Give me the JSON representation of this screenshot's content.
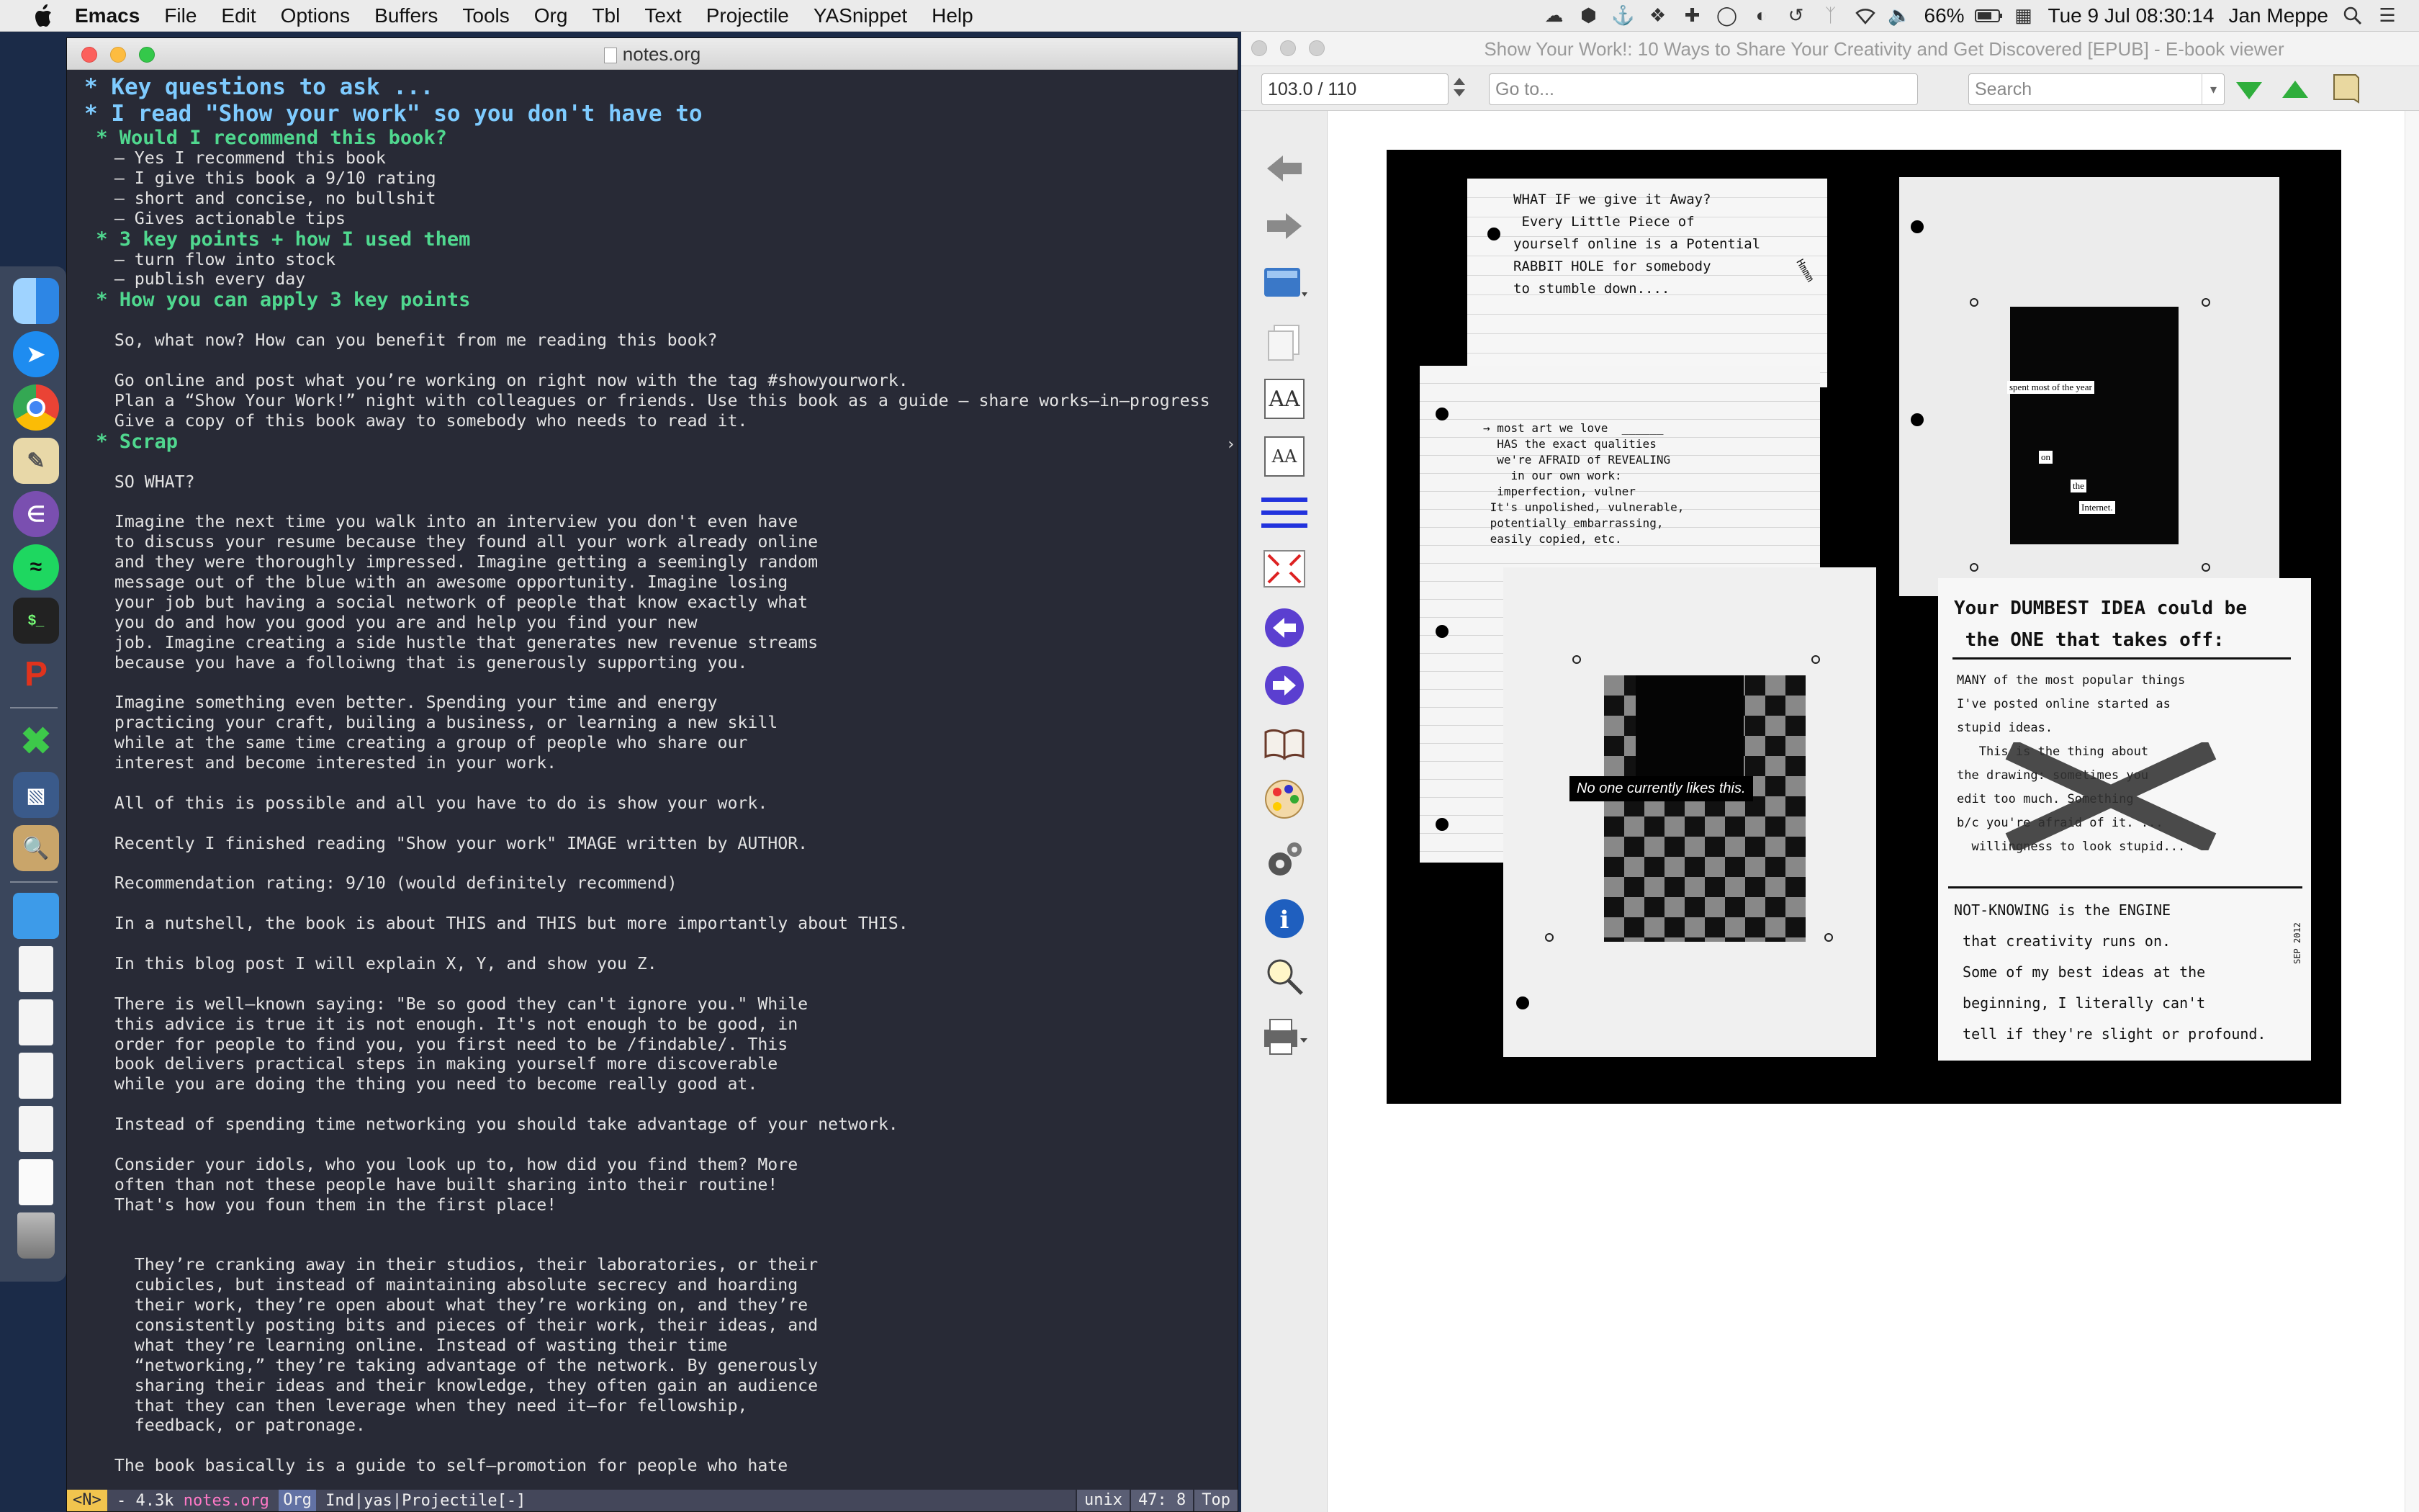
{
  "menubar": {
    "app_name": "Emacs",
    "menus": [
      "File",
      "Edit",
      "Options",
      "Buffers",
      "Tools",
      "Org",
      "Tbl",
      "Text",
      "Projectile",
      "YASnippet",
      "Help"
    ],
    "battery": "66%",
    "datetime": "Tue 9 Jul  08:30:14",
    "user": "Jan Meppe"
  },
  "emacs": {
    "title": "notes.org",
    "lines": [
      {
        "t": "* Key questions to ask ...",
        "s": "h1"
      },
      {
        "t": "* I read \"Show your work\" so you don't have to",
        "s": "h1"
      },
      {
        "t": " * Would I recommend this book?",
        "s": "h2"
      },
      {
        "t": "   – Yes I recommend this book",
        "s": ""
      },
      {
        "t": "   – I give this book a 9/10 rating",
        "s": ""
      },
      {
        "t": "   – short and concise, no bullshit",
        "s": ""
      },
      {
        "t": "   – Gives actionable tips",
        "s": ""
      },
      {
        "t": " * 3 key points + how I used them",
        "s": "h2"
      },
      {
        "t": "   – turn flow into stock",
        "s": ""
      },
      {
        "t": "   – publish every day",
        "s": ""
      },
      {
        "t": " * How you can apply 3 key points",
        "s": "h2"
      },
      {
        "t": "",
        "s": ""
      },
      {
        "t": "   So, what now? How can you benefit from me reading this book?",
        "s": ""
      },
      {
        "t": "",
        "s": ""
      },
      {
        "t": "   Go online and post what you’re working on right now with the tag #showyourwork.",
        "s": ""
      },
      {
        "t": "   Plan a “Show Your Work!” night with colleagues or friends. Use this book as a guide — share works–in–progress",
        "s": ""
      },
      {
        "t": "   Give a copy of this book away to somebody who needs to read it.",
        "s": ""
      },
      {
        "t": " * Scrap",
        "s": "h2"
      },
      {
        "t": "",
        "s": ""
      },
      {
        "t": "   SO WHAT?",
        "s": ""
      },
      {
        "t": "",
        "s": ""
      },
      {
        "t": "   Imagine the next time you walk into an interview you don't even have",
        "s": ""
      },
      {
        "t": "   to discuss your resume because they found all your work already online",
        "s": ""
      },
      {
        "t": "   and they were thoroughly impressed. Imagine getting a seemingly random",
        "s": ""
      },
      {
        "t": "   message out of the blue with an awesome opportunity. Imagine losing",
        "s": ""
      },
      {
        "t": "   your job but having a social network of people that know exactly what",
        "s": ""
      },
      {
        "t": "   you do and how you good you are and help you find your new",
        "s": ""
      },
      {
        "t": "   job. Imagine creating a side hustle that generates new revenue streams",
        "s": ""
      },
      {
        "t": "   because you have a folloiwng that is generously supporting you.",
        "s": ""
      },
      {
        "t": "",
        "s": ""
      },
      {
        "t": "   Imagine something even better. Spending your time and energy",
        "s": ""
      },
      {
        "t": "   practicing your craft, builing a business, or learning a new skill",
        "s": ""
      },
      {
        "t": "   while at the same time creating a group of people who share our",
        "s": ""
      },
      {
        "t": "   interest and become interested in your work.",
        "s": ""
      },
      {
        "t": "",
        "s": ""
      },
      {
        "t": "   All of this is possible and all you have to do is show your work.",
        "s": ""
      },
      {
        "t": "",
        "s": ""
      },
      {
        "t": "   Recently I finished reading \"Show your work\" IMAGE written by AUTHOR.",
        "s": ""
      },
      {
        "t": "",
        "s": ""
      },
      {
        "t": "   Recommendation rating: 9/10 (would definitely recommend)",
        "s": ""
      },
      {
        "t": "",
        "s": ""
      },
      {
        "t": "   In a nutshell, the book is about THIS and THIS but more importantly about THIS.",
        "s": ""
      },
      {
        "t": "",
        "s": ""
      },
      {
        "t": "   In this blog post I will explain X, Y, and show you Z.",
        "s": ""
      },
      {
        "t": "",
        "s": ""
      },
      {
        "t": "   There is well–known saying: \"Be so good they can't ignore you.\" While",
        "s": ""
      },
      {
        "t": "   this advice is true it is not enough. It's not enough to be good, in",
        "s": ""
      },
      {
        "t": "   order for people to find you, you first need to be /findable/. This",
        "s": ""
      },
      {
        "t": "   book delivers practical steps in making yourself more discoverable",
        "s": ""
      },
      {
        "t": "   while you are doing the thing you need to become really good at.",
        "s": ""
      },
      {
        "t": "",
        "s": ""
      },
      {
        "t": "   Instead of spending time networking you should take advantage of your network.",
        "s": ""
      },
      {
        "t": "",
        "s": ""
      },
      {
        "t": "   Consider your idols, who you look up to, how did you find them? More",
        "s": ""
      },
      {
        "t": "   often than not these people have built sharing into their routine!",
        "s": ""
      },
      {
        "t": "   That's how you foun them in the first place!",
        "s": ""
      },
      {
        "t": "",
        "s": ""
      },
      {
        "t": "",
        "s": ""
      },
      {
        "t": "     They’re cranking away in their studios, their laboratories, or their",
        "s": ""
      },
      {
        "t": "     cubicles, but instead of maintaining absolute secrecy and hoarding",
        "s": ""
      },
      {
        "t": "     their work, they’re open about what they’re working on, and they’re",
        "s": ""
      },
      {
        "t": "     consistently posting bits and pieces of their work, their ideas, and",
        "s": ""
      },
      {
        "t": "     what they’re learning online. Instead of wasting their time",
        "s": ""
      },
      {
        "t": "     “networking,” they’re taking advantage of the network. By generously",
        "s": ""
      },
      {
        "t": "     sharing their ideas and their knowledge, they often gain an audience",
        "s": ""
      },
      {
        "t": "     that they can then leverage when they need it—for fellowship,",
        "s": ""
      },
      {
        "t": "     feedback, or patronage.",
        "s": ""
      },
      {
        "t": "",
        "s": ""
      },
      {
        "t": "   The book basically is a guide to self–promotion for people who hate",
        "s": ""
      }
    ],
    "modeline": {
      "evil_state": "<N>",
      "size": " - 4.3k ",
      "buffer": "notes.org",
      "major_mode": "Org",
      "minor_modes": " Ind|yas|Projectile[-]",
      "encoding": "unix",
      "position": "47: 8",
      "scroll": "Top"
    }
  },
  "viewer": {
    "title": "Show Your Work!: 10 Ways to Share Your Creativity and Get Discovered [EPUB] - E-book viewer",
    "page_position": "103.0 / 110",
    "goto_placeholder": "Go to...",
    "search_placeholder": "Search",
    "book_page": {
      "note1": "WHAT IF we give it Away?\n Every Little Piece of\nyourself online is a Potential\nRABBIT HOLE for somebody\nto stumble down....",
      "note1_side": "Hmmm",
      "note2": "→ most art we love  ______\n  HAS the exact qualities\n  we're AFRAID of REVEALING\n    in our own work:\n  imperfection, vulner\n It's unpolished, vulnerable,\n potentially embarrassing,\n easily copied, etc.",
      "blackout_words": [
        "spent most of the year",
        "on",
        "the",
        "Internet."
      ],
      "caption": "No one currently likes this.",
      "note3_title": "Your DUMBEST IDEA could be\n the ONE that takes off:",
      "note3_body": "MANY of the most popular things\nI've posted online started as\nstupid ideas.\n   This is the thing about\nthe drawing: sometimes you\nedit too much. Something\nb/c you're afraid of it. ...\n  willingness to look stupid...",
      "note3_footer": "NOT-KNOWING is the ENGINE\n that creativity runs on.\n Some of my best ideas at the\n beginning, I literally can't\n tell if they're slight or profound.",
      "stamp": "SEP 2012"
    }
  },
  "colors": {
    "heading1": "#7ecbff",
    "heading2": "#50d88f",
    "editor_bg": "#282a36",
    "modeline_bg": "#44475a",
    "buffer_name": "#ff79c6",
    "nav_arrow": "#2d7cf0"
  }
}
